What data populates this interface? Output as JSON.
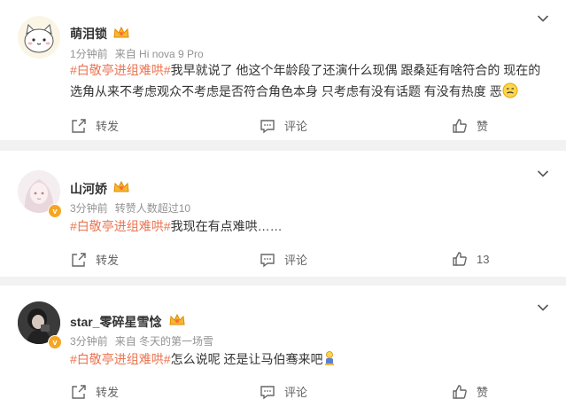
{
  "comments": [
    {
      "name": "萌泪锁",
      "time": "1分钟前",
      "source": "来自 Hi nova 9 Pro",
      "topic": "#白敬亭进组难哄#",
      "text_line1": "我早就说了 他这个年龄段了还演什么现偶 跟桑延有啥符合的 现在的",
      "text_line2": "选角从来不考虑观众不考虑是否符合角色本身 只考虑有没有话题 有没有热度 恶",
      "repost": "转发",
      "comment": "评论",
      "like": "赞"
    },
    {
      "name": "山河娇",
      "time": "3分钟前",
      "source": "转赞人数超过10",
      "topic": "#白敬亭进组难哄#",
      "text_line1": "我现在有点难哄……",
      "repost": "转发",
      "comment": "评论",
      "like": "13"
    },
    {
      "name": "star_零碎星雪惗",
      "time": "3分钟前",
      "source": "来自 冬天的第一场雪",
      "topic": "#白敬亭进组难哄#",
      "text_line1": "怎么说呢 还是让马伯骞来吧",
      "repost": "转发",
      "comment": "评论",
      "like": "赞"
    }
  ],
  "colors": {
    "topic": "#eb7350",
    "meta": "#939393",
    "background": "#f2f2f2",
    "badge": "#f5a623"
  }
}
